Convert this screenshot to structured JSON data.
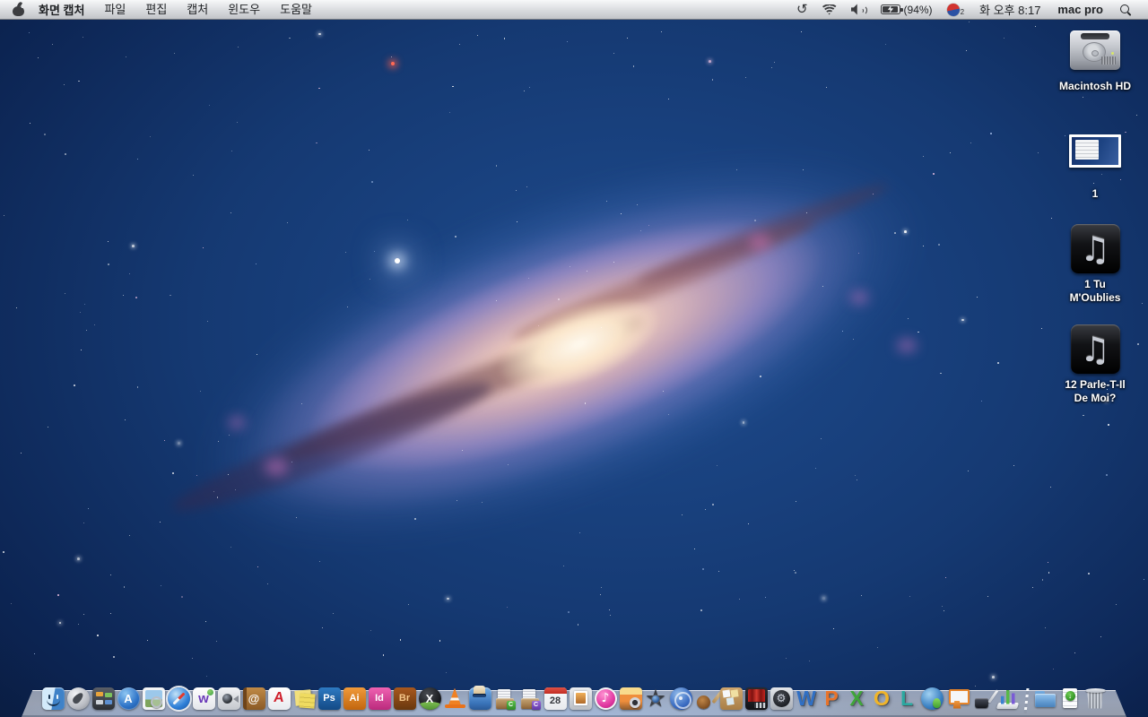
{
  "menubar": {
    "app_name": "화면 캡처",
    "menus": [
      "파일",
      "편집",
      "캡처",
      "윈도우",
      "도움말"
    ],
    "status": {
      "icons": [
        "time-machine-icon",
        "wifi-icon",
        "volume-icon",
        "battery-icon",
        "korean-input-flag-icon",
        "spotlight-icon"
      ],
      "battery_percent": "(94%)",
      "input_badge": "2",
      "datetime": "화 오후 8:17",
      "username": "mac pro"
    }
  },
  "desktop": {
    "icons": [
      {
        "id": "macintosh-hd",
        "icon": "hard-drive-icon",
        "line1": "Macintosh HD",
        "line2": ""
      },
      {
        "id": "screenshot-file",
        "icon": "screenshot-thumbnail-icon",
        "line1": "1",
        "line2": ""
      },
      {
        "id": "audio-file-1",
        "icon": "music-note-icon",
        "line1": "1 Tu",
        "line2": "M'Oublies"
      },
      {
        "id": "audio-file-2",
        "icon": "music-note-icon",
        "line1": "12 Parle-T-Il",
        "line2": "De Moi?"
      }
    ],
    "music_note_glyph": "♫"
  },
  "dock": {
    "apps": [
      {
        "id": "finder"
      },
      {
        "id": "launchpad"
      },
      {
        "id": "mission-control"
      },
      {
        "id": "app-store",
        "glyph": "A"
      },
      {
        "id": "preview"
      },
      {
        "id": "safari"
      },
      {
        "id": "wedisk",
        "glyph": "w"
      },
      {
        "id": "facetime"
      },
      {
        "id": "address-book",
        "glyph": "@"
      },
      {
        "id": "adobe-reader",
        "glyph": "A"
      },
      {
        "id": "stickies"
      },
      {
        "id": "photoshop",
        "glyph": "Ps"
      },
      {
        "id": "illustrator",
        "glyph": "Ai"
      },
      {
        "id": "indesign",
        "glyph": "Id"
      },
      {
        "id": "bridge",
        "glyph": "Br"
      },
      {
        "id": "x-image-app",
        "glyph": "X"
      },
      {
        "id": "vlc"
      },
      {
        "id": "toast"
      },
      {
        "id": "converter-crate-1",
        "glyph": "C"
      },
      {
        "id": "converter-crate-2",
        "glyph": "C"
      },
      {
        "id": "ical",
        "glyph": "28"
      },
      {
        "id": "photo-booth"
      },
      {
        "id": "itunes",
        "glyph": "♪"
      },
      {
        "id": "iphoto"
      },
      {
        "id": "imovie",
        "glyph": "★"
      },
      {
        "id": "idvd"
      },
      {
        "id": "garageband"
      },
      {
        "id": "corkboard-app"
      },
      {
        "id": "movie-theater-app"
      },
      {
        "id": "gears-utility-app",
        "glyph": "⚙"
      },
      {
        "id": "ms-word",
        "glyph": "W"
      },
      {
        "id": "ms-powerpoint",
        "glyph": "P"
      },
      {
        "id": "ms-excel",
        "glyph": "X"
      },
      {
        "id": "ms-outlook",
        "glyph": "O"
      },
      {
        "id": "ms-lync",
        "glyph": "L"
      },
      {
        "id": "messenger"
      },
      {
        "id": "keynote"
      },
      {
        "id": "pages"
      },
      {
        "id": "numbers"
      }
    ],
    "stacks": [
      {
        "id": "documents-folder"
      },
      {
        "id": "downloads",
        "glyph": "↓"
      }
    ],
    "trash": {
      "id": "trash"
    }
  },
  "colors": {
    "desktop_blue": "#153972",
    "galaxy_core": "#fffaef",
    "menubar_gray": "#d9dbde"
  }
}
